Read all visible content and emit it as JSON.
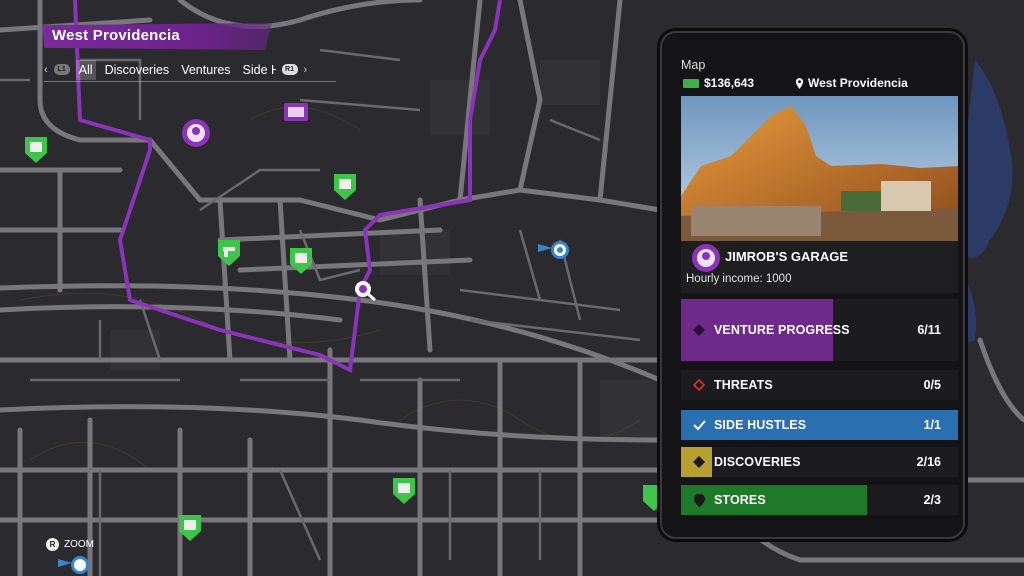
{
  "region": {
    "title": "West Providencia"
  },
  "filters": {
    "left_button": "L1",
    "right_button": "R1",
    "tabs": [
      "All",
      "Discoveries",
      "Ventures",
      "Side Hustles"
    ],
    "selected": "All"
  },
  "zoom_hint": {
    "button": "R",
    "label": "ZOOM"
  },
  "phone": {
    "app_title": "Map",
    "cash": "$136,643",
    "location": "West Providencia",
    "venture": {
      "name": "JIMROB'S GARAGE",
      "income": "Hourly income: 1000"
    },
    "stats": [
      {
        "label": "VENTURE PROGRESS",
        "value": "6/11",
        "progress": 0.55,
        "color": "#6e2a8a",
        "accent": "#9a3fbf",
        "icon": "diamond-icon"
      },
      {
        "label": "THREATS",
        "value": "0/5",
        "progress": 0,
        "color": "#c42020",
        "accent": "#d83030",
        "icon": "diamond-outline-icon"
      },
      {
        "label": "SIDE HUSTLES",
        "value": "1/1",
        "progress": 1.0,
        "color": "#2a6fb0",
        "accent": "#3a85c9",
        "icon": "check-icon"
      },
      {
        "label": "DISCOVERIES",
        "value": "2/16",
        "progress": 0.125,
        "color": "#b8a030",
        "accent": "#d6bd3a",
        "icon": "diamond-filled-icon"
      },
      {
        "label": "STORES",
        "value": "2/3",
        "progress": 0.67,
        "color": "#1e7a2a",
        "accent": "#2a9a38",
        "icon": "shield-icon"
      }
    ]
  },
  "colors": {
    "district_border": "#8a34b8",
    "road": "#7a7a7e",
    "background": "#2a2a2e",
    "store_marker": "#3fc44a"
  }
}
